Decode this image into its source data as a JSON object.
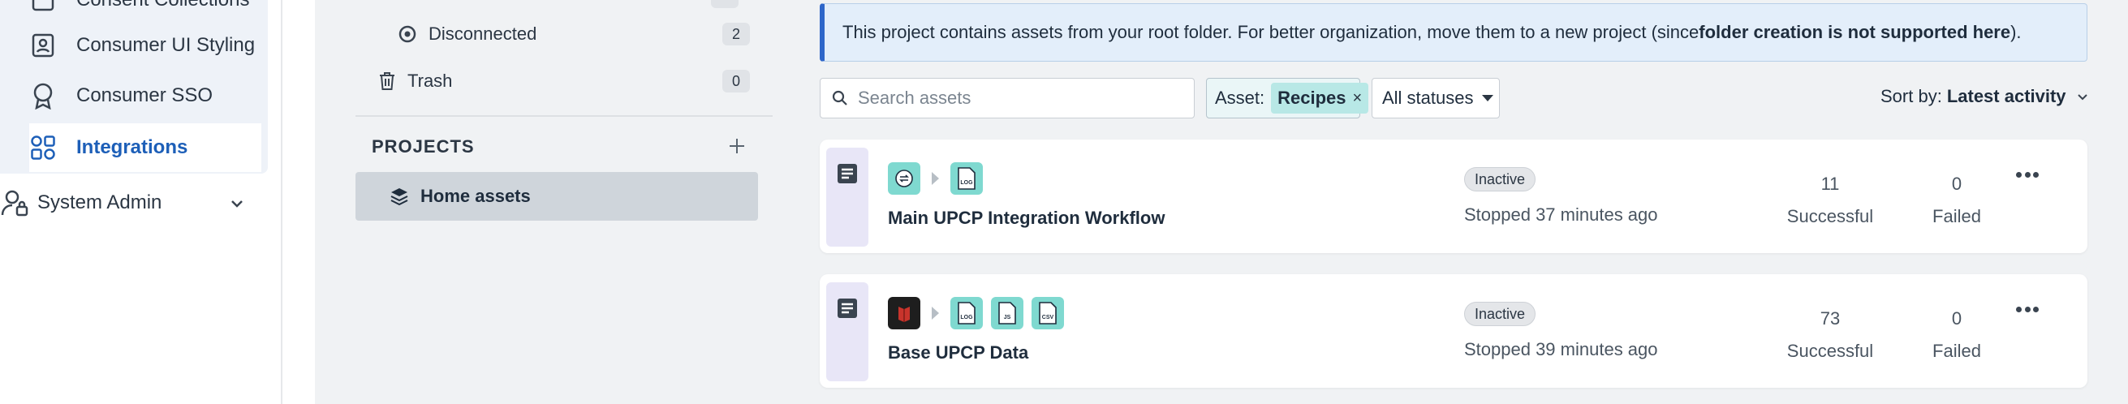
{
  "left_nav": {
    "items": [
      {
        "label": "Consent Collections",
        "icon": "consent-collections-icon"
      },
      {
        "label": "Consumer UI Styling",
        "icon": "user-card-icon"
      },
      {
        "label": "Consumer SSO",
        "icon": "badge-icon"
      },
      {
        "label": "Integrations",
        "icon": "grid-icon",
        "active": true
      }
    ],
    "system_admin": "System Admin"
  },
  "folders": {
    "disconnected": {
      "label": "Disconnected",
      "count": "2"
    },
    "trash": {
      "label": "Trash",
      "count": "0"
    },
    "projects_header": "PROJECTS",
    "home_assets": "Home assets"
  },
  "notice": {
    "text_before": "This project contains assets from your root folder. For better organization, move them to a new project (since ",
    "bold": "folder creation is not supported here",
    "text_after": ")."
  },
  "toolbar": {
    "search_placeholder": "Search assets",
    "asset_filter_label": "Asset:",
    "asset_filter_value": "Recipes",
    "asset_filter_remove": "×",
    "status_select": "All statuses",
    "sort_label": "Sort by:",
    "sort_value": "Latest activity"
  },
  "recipes": [
    {
      "title": "Main UPCP Integration Workflow",
      "status": "Inactive",
      "stopped": "Stopped 37 minutes ago",
      "successful_count": "11",
      "successful_label": "Successful",
      "failed_count": "0",
      "failed_label": "Failed",
      "apps": [
        "sync-app-icon",
        "log-file-icon"
      ]
    },
    {
      "title": "Base UPCP Data",
      "status": "Inactive",
      "stopped": "Stopped 39 minutes ago",
      "successful_count": "73",
      "successful_label": "Successful",
      "failed_count": "0",
      "failed_label": "Failed",
      "apps": [
        "red-app-icon",
        "log-file-icon",
        "js-file-icon",
        "csv-file-icon"
      ]
    }
  ],
  "file_icon_labels": {
    "log": "LOG",
    "js": "JS",
    "csv": "CSV"
  },
  "colors": {
    "accent": "#1d5fb8",
    "notice_border": "#2e66c9",
    "app_teal": "#7fd9d0",
    "chip": "#b8e8e6"
  }
}
